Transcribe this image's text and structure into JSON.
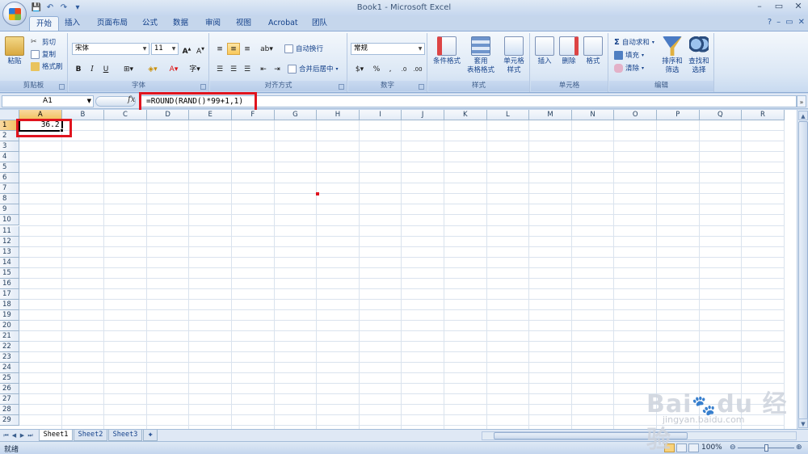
{
  "window": {
    "title": "Book1 - Microsoft Excel",
    "controls": [
      "–",
      "▭",
      "✕"
    ]
  },
  "quick_access": [
    "💾",
    "↶",
    "↷",
    "▾"
  ],
  "tabs": [
    {
      "label": "开始",
      "active": true
    },
    {
      "label": "插入"
    },
    {
      "label": "页面布局"
    },
    {
      "label": "公式"
    },
    {
      "label": "数据"
    },
    {
      "label": "审阅"
    },
    {
      "label": "视图"
    },
    {
      "label": "Acrobat"
    },
    {
      "label": "团队"
    }
  ],
  "ribbon": {
    "clipboard": {
      "label": "剪贴板",
      "paste": "粘贴",
      "cut": "剪切",
      "copy": "复制",
      "format_painter": "格式刷"
    },
    "font": {
      "label": "字体",
      "font_name": "宋体",
      "font_size": "11",
      "bold": "B",
      "italic": "I",
      "underline": "U"
    },
    "alignment": {
      "label": "对齐方式",
      "wrap_text": "自动换行",
      "merge_center": "合并后居中"
    },
    "number": {
      "label": "数字",
      "format": "常规",
      "percent": "%"
    },
    "styles": {
      "label": "样式",
      "conditional": "条件格式",
      "table_format_1": "套用",
      "table_format_2": "表格格式",
      "cell_styles_1": "单元格",
      "cell_styles_2": "样式"
    },
    "cells": {
      "label": "单元格",
      "insert": "插入",
      "delete": "删除",
      "format": "格式"
    },
    "editing": {
      "label": "编辑",
      "autosum": "自动求和",
      "fill": "填充",
      "clear": "清除",
      "sort_1": "排序和",
      "sort_2": "筛选",
      "find_1": "查找和",
      "find_2": "选择"
    }
  },
  "formula_bar": {
    "name_box": "A1",
    "fx": "fx",
    "formula": "=ROUND(RAND()*99+1,1)"
  },
  "grid": {
    "columns": [
      "A",
      "B",
      "C",
      "D",
      "E",
      "F",
      "G",
      "H",
      "I",
      "J",
      "K",
      "L",
      "M",
      "N",
      "O",
      "P",
      "Q",
      "R"
    ],
    "rows": [
      "1",
      "2",
      "3",
      "4",
      "5",
      "6",
      "7",
      "8",
      "9",
      "10",
      "11",
      "12",
      "13",
      "14",
      "15",
      "16",
      "17",
      "18",
      "19",
      "20",
      "21",
      "22",
      "23",
      "24",
      "25",
      "26",
      "27",
      "28",
      "29"
    ],
    "selected_cell": "A1",
    "a1_value": "36.2"
  },
  "sheets": [
    {
      "label": "Sheet1",
      "active": true
    },
    {
      "label": "Sheet2"
    },
    {
      "label": "Sheet3"
    }
  ],
  "status": {
    "ready": "就绪",
    "zoom": "100%"
  },
  "colors": {
    "highlight_red": "#e0141e",
    "ribbon_blue": "#15428b"
  }
}
